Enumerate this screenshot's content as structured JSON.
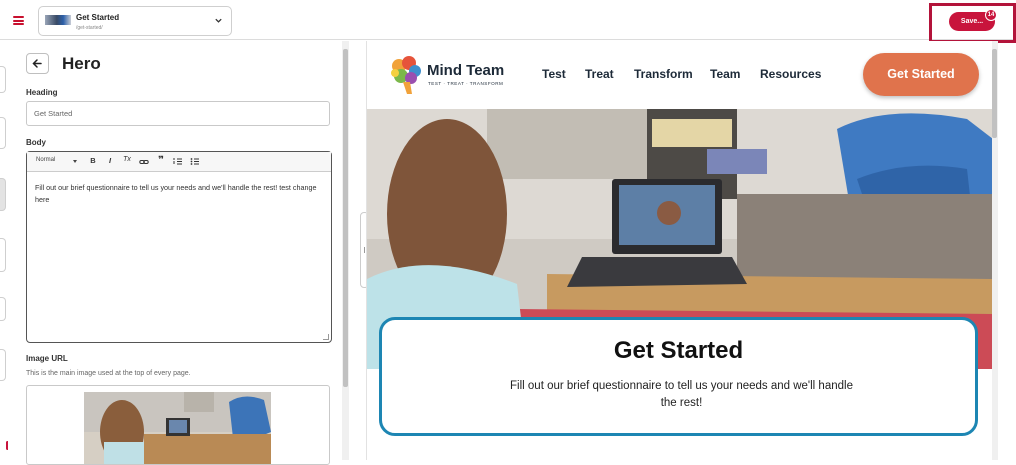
{
  "topbar": {
    "menu_icon": "hamburger-icon",
    "page_selector": {
      "title": "Get Started",
      "slug": "/get-started/",
      "chevron": "chevron-down-icon"
    },
    "save_label": "Save...",
    "save_badge": "14",
    "accent": "#c8143c"
  },
  "editor": {
    "back_icon": "arrow-left-icon",
    "title": "Hero",
    "heading_label": "Heading",
    "heading_value": "Get Started",
    "body_label": "Body",
    "rte": {
      "format": "Normal",
      "tools": [
        "B",
        "I",
        "Tx",
        "link",
        "quote",
        "ordered-list",
        "bullet-list"
      ],
      "content": "Fill out our brief questionnaire to tell us your needs and we'll handle the rest! test change here"
    },
    "image_label": "Image URL",
    "image_help": "This is the main image used at the top of every page."
  },
  "preview": {
    "logo_name": "Mind Team",
    "logo_tagline": "TEST · TREAT · TRANSFORM",
    "nav": [
      "Test",
      "Treat",
      "Transform",
      "Team",
      "Resources"
    ],
    "cta_label": "Get Started",
    "cta_color": "#e0734c",
    "hero_title": "Get Started",
    "hero_body": "Fill out our brief questionnaire to tell us your needs and we'll handle the rest!",
    "card_border": "#1d86b3"
  }
}
